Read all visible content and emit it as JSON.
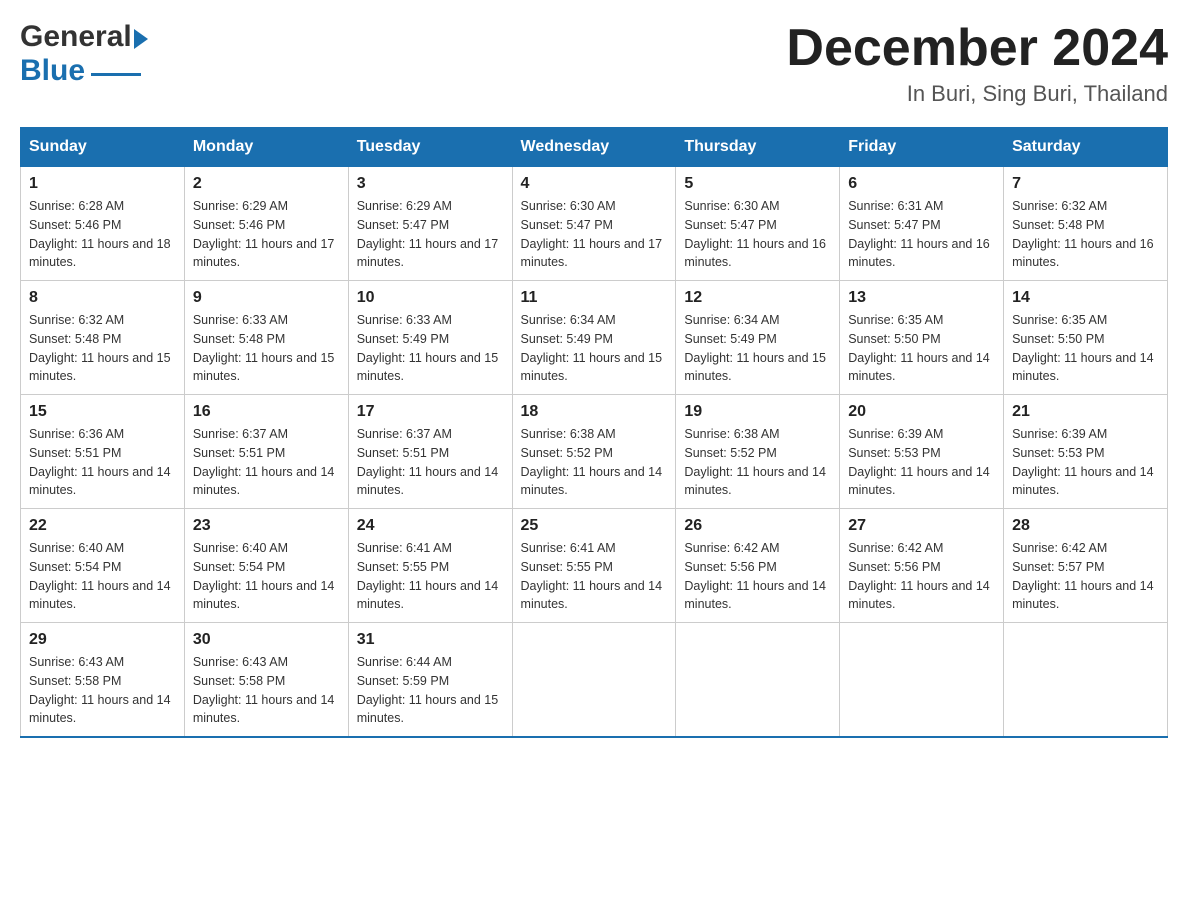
{
  "header": {
    "logo": {
      "general": "General",
      "blue": "Blue",
      "triangle": "▶"
    },
    "month_title": "December 2024",
    "location": "In Buri, Sing Buri, Thailand"
  },
  "calendar": {
    "days_of_week": [
      "Sunday",
      "Monday",
      "Tuesday",
      "Wednesday",
      "Thursday",
      "Friday",
      "Saturday"
    ],
    "weeks": [
      [
        {
          "day": "1",
          "sunrise": "6:28 AM",
          "sunset": "5:46 PM",
          "daylight": "11 hours and 18 minutes."
        },
        {
          "day": "2",
          "sunrise": "6:29 AM",
          "sunset": "5:46 PM",
          "daylight": "11 hours and 17 minutes."
        },
        {
          "day": "3",
          "sunrise": "6:29 AM",
          "sunset": "5:47 PM",
          "daylight": "11 hours and 17 minutes."
        },
        {
          "day": "4",
          "sunrise": "6:30 AM",
          "sunset": "5:47 PM",
          "daylight": "11 hours and 17 minutes."
        },
        {
          "day": "5",
          "sunrise": "6:30 AM",
          "sunset": "5:47 PM",
          "daylight": "11 hours and 16 minutes."
        },
        {
          "day": "6",
          "sunrise": "6:31 AM",
          "sunset": "5:47 PM",
          "daylight": "11 hours and 16 minutes."
        },
        {
          "day": "7",
          "sunrise": "6:32 AM",
          "sunset": "5:48 PM",
          "daylight": "11 hours and 16 minutes."
        }
      ],
      [
        {
          "day": "8",
          "sunrise": "6:32 AM",
          "sunset": "5:48 PM",
          "daylight": "11 hours and 15 minutes."
        },
        {
          "day": "9",
          "sunrise": "6:33 AM",
          "sunset": "5:48 PM",
          "daylight": "11 hours and 15 minutes."
        },
        {
          "day": "10",
          "sunrise": "6:33 AM",
          "sunset": "5:49 PM",
          "daylight": "11 hours and 15 minutes."
        },
        {
          "day": "11",
          "sunrise": "6:34 AM",
          "sunset": "5:49 PM",
          "daylight": "11 hours and 15 minutes."
        },
        {
          "day": "12",
          "sunrise": "6:34 AM",
          "sunset": "5:49 PM",
          "daylight": "11 hours and 15 minutes."
        },
        {
          "day": "13",
          "sunrise": "6:35 AM",
          "sunset": "5:50 PM",
          "daylight": "11 hours and 14 minutes."
        },
        {
          "day": "14",
          "sunrise": "6:35 AM",
          "sunset": "5:50 PM",
          "daylight": "11 hours and 14 minutes."
        }
      ],
      [
        {
          "day": "15",
          "sunrise": "6:36 AM",
          "sunset": "5:51 PM",
          "daylight": "11 hours and 14 minutes."
        },
        {
          "day": "16",
          "sunrise": "6:37 AM",
          "sunset": "5:51 PM",
          "daylight": "11 hours and 14 minutes."
        },
        {
          "day": "17",
          "sunrise": "6:37 AM",
          "sunset": "5:51 PM",
          "daylight": "11 hours and 14 minutes."
        },
        {
          "day": "18",
          "sunrise": "6:38 AM",
          "sunset": "5:52 PM",
          "daylight": "11 hours and 14 minutes."
        },
        {
          "day": "19",
          "sunrise": "6:38 AM",
          "sunset": "5:52 PM",
          "daylight": "11 hours and 14 minutes."
        },
        {
          "day": "20",
          "sunrise": "6:39 AM",
          "sunset": "5:53 PM",
          "daylight": "11 hours and 14 minutes."
        },
        {
          "day": "21",
          "sunrise": "6:39 AM",
          "sunset": "5:53 PM",
          "daylight": "11 hours and 14 minutes."
        }
      ],
      [
        {
          "day": "22",
          "sunrise": "6:40 AM",
          "sunset": "5:54 PM",
          "daylight": "11 hours and 14 minutes."
        },
        {
          "day": "23",
          "sunrise": "6:40 AM",
          "sunset": "5:54 PM",
          "daylight": "11 hours and 14 minutes."
        },
        {
          "day": "24",
          "sunrise": "6:41 AM",
          "sunset": "5:55 PM",
          "daylight": "11 hours and 14 minutes."
        },
        {
          "day": "25",
          "sunrise": "6:41 AM",
          "sunset": "5:55 PM",
          "daylight": "11 hours and 14 minutes."
        },
        {
          "day": "26",
          "sunrise": "6:42 AM",
          "sunset": "5:56 PM",
          "daylight": "11 hours and 14 minutes."
        },
        {
          "day": "27",
          "sunrise": "6:42 AM",
          "sunset": "5:56 PM",
          "daylight": "11 hours and 14 minutes."
        },
        {
          "day": "28",
          "sunrise": "6:42 AM",
          "sunset": "5:57 PM",
          "daylight": "11 hours and 14 minutes."
        }
      ],
      [
        {
          "day": "29",
          "sunrise": "6:43 AM",
          "sunset": "5:58 PM",
          "daylight": "11 hours and 14 minutes."
        },
        {
          "day": "30",
          "sunrise": "6:43 AM",
          "sunset": "5:58 PM",
          "daylight": "11 hours and 14 minutes."
        },
        {
          "day": "31",
          "sunrise": "6:44 AM",
          "sunset": "5:59 PM",
          "daylight": "11 hours and 15 minutes."
        },
        null,
        null,
        null,
        null
      ]
    ]
  }
}
